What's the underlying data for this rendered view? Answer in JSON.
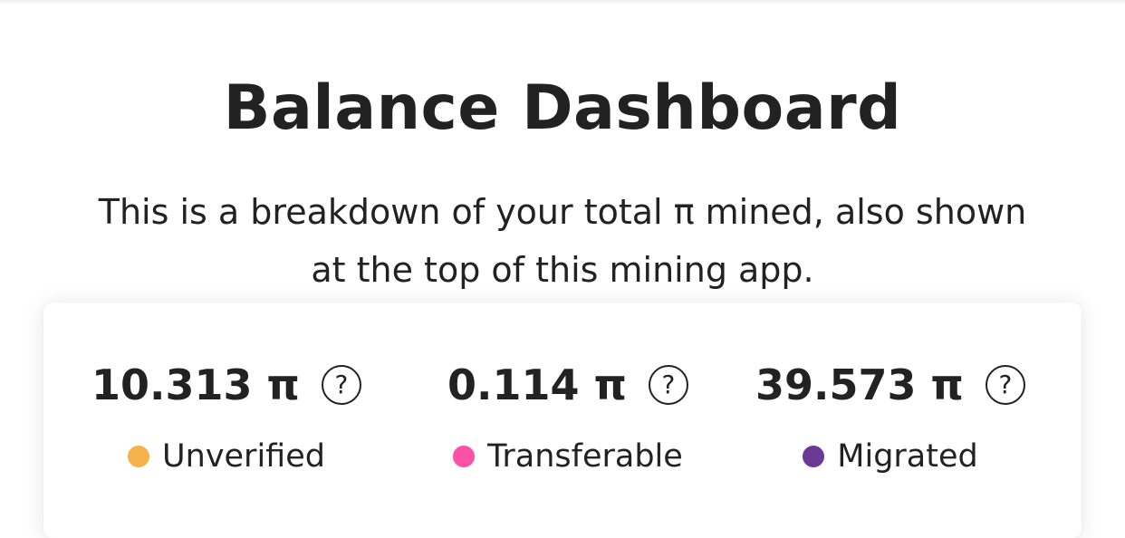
{
  "page": {
    "title": "Balance Dashboard",
    "description": "This is a breakdown of your total π mined, also shown at the top of this mining app."
  },
  "balances": [
    {
      "value": "10.313 π",
      "label": "Unverified",
      "help_icon": "question-circle-icon",
      "help_text": "?",
      "color": "#f6b14a"
    },
    {
      "value": "0.114 π",
      "label": "Transferable",
      "help_icon": "question-circle-icon",
      "help_text": "?",
      "color": "#fb50a6"
    },
    {
      "value": "39.573 π",
      "label": "Migrated",
      "help_icon": "question-circle-icon",
      "help_text": "?",
      "color": "#6c3996"
    }
  ]
}
